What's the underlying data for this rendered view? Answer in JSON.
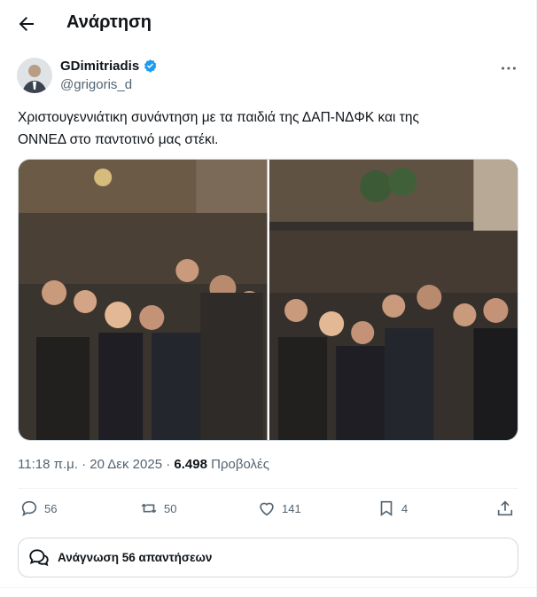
{
  "header": {
    "title": "Ανάρτηση"
  },
  "author": {
    "name": "GDimitriadis",
    "handle": "@grigoris_d",
    "verified": true
  },
  "post": {
    "text_line1": "Χριστουγεννιάτικη συνάντηση με τα παιδιά της ΔΑΠ-ΝΔΦΚ και της",
    "text_line2": "ΟΝΝΕΔ στο παντοτινό μας στέκι.",
    "time": "11:18 π.μ.",
    "date": "20 Δεκ 2025",
    "views": "6.498",
    "views_label": "Προβολές"
  },
  "actions": {
    "replies": "56",
    "reposts": "50",
    "likes": "141",
    "bookmarks": "4"
  },
  "read_replies": {
    "prefix": "Ανάγνωση",
    "count": "56",
    "suffix": "απαντήσεων"
  },
  "colors": {
    "verified": "#1d9bf0",
    "text": "#0f1419",
    "secondary": "#536471",
    "border": "#cfd9de"
  },
  "icons": [
    "back-arrow-icon",
    "verified-badge-icon",
    "more-icon",
    "reply-icon",
    "repost-icon",
    "like-icon",
    "bookmark-icon",
    "share-icon",
    "speech-bubbles-icon"
  ]
}
